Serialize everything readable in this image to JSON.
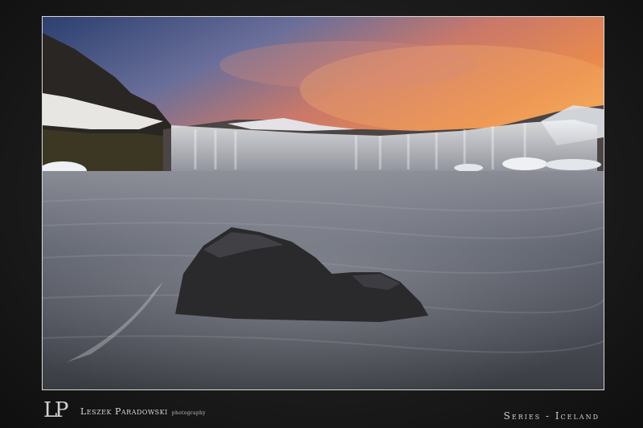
{
  "photo": {
    "subject": "waterfall-landscape",
    "palette": {
      "sky_warm": "#e27a4a",
      "sky_cool": "#3f5f8f",
      "water": "#6b6f78",
      "rock": "#2c2c2e",
      "snow": "#e9edf2"
    }
  },
  "footer": {
    "monogram": "LP",
    "brand_name": "Leszek Paradowski",
    "brand_sub": "photography",
    "series": "Series - Iceland"
  }
}
